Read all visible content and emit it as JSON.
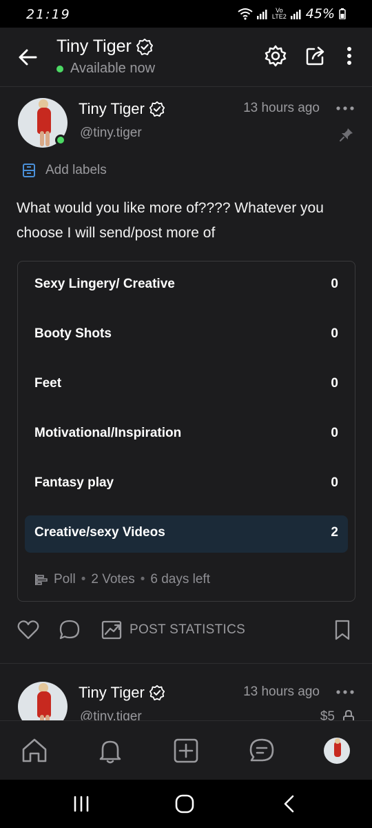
{
  "status_bar": {
    "time": "21:19",
    "battery": "45%",
    "network": "LTE2",
    "carrier_tag": "Vo"
  },
  "header": {
    "title": "Tiny Tiger",
    "status": "Available now"
  },
  "post": {
    "author": "Tiny Tiger",
    "handle": "@tiny.tiger",
    "time": "13 hours ago",
    "add_labels": "Add labels",
    "text": "What would you like more of???? Whatever you choose I will send/post more of",
    "poll": {
      "options": [
        {
          "label": "Sexy Lingery/ Creative",
          "count": "0"
        },
        {
          "label": "Booty Shots",
          "count": "0"
        },
        {
          "label": "Feet",
          "count": "0"
        },
        {
          "label": "Motivational/Inspiration",
          "count": "0"
        },
        {
          "label": "Fantasy play",
          "count": "0"
        },
        {
          "label": "Creative/sexy Videos",
          "count": "2",
          "selected": true
        }
      ],
      "footer": {
        "type": "Poll",
        "votes": "2 Votes",
        "remaining": "6 days left"
      }
    },
    "actions": {
      "statistics_label": "POST STATISTICS"
    }
  },
  "next_post": {
    "author": "Tiny Tiger",
    "handle": "@tiny.tiger",
    "time": "13 hours ago",
    "price": "$5"
  },
  "colors": {
    "background": "#1c1c1e",
    "accent": "#4a90d9",
    "online": "#4cd964",
    "selected_option": "#1b2a38"
  }
}
